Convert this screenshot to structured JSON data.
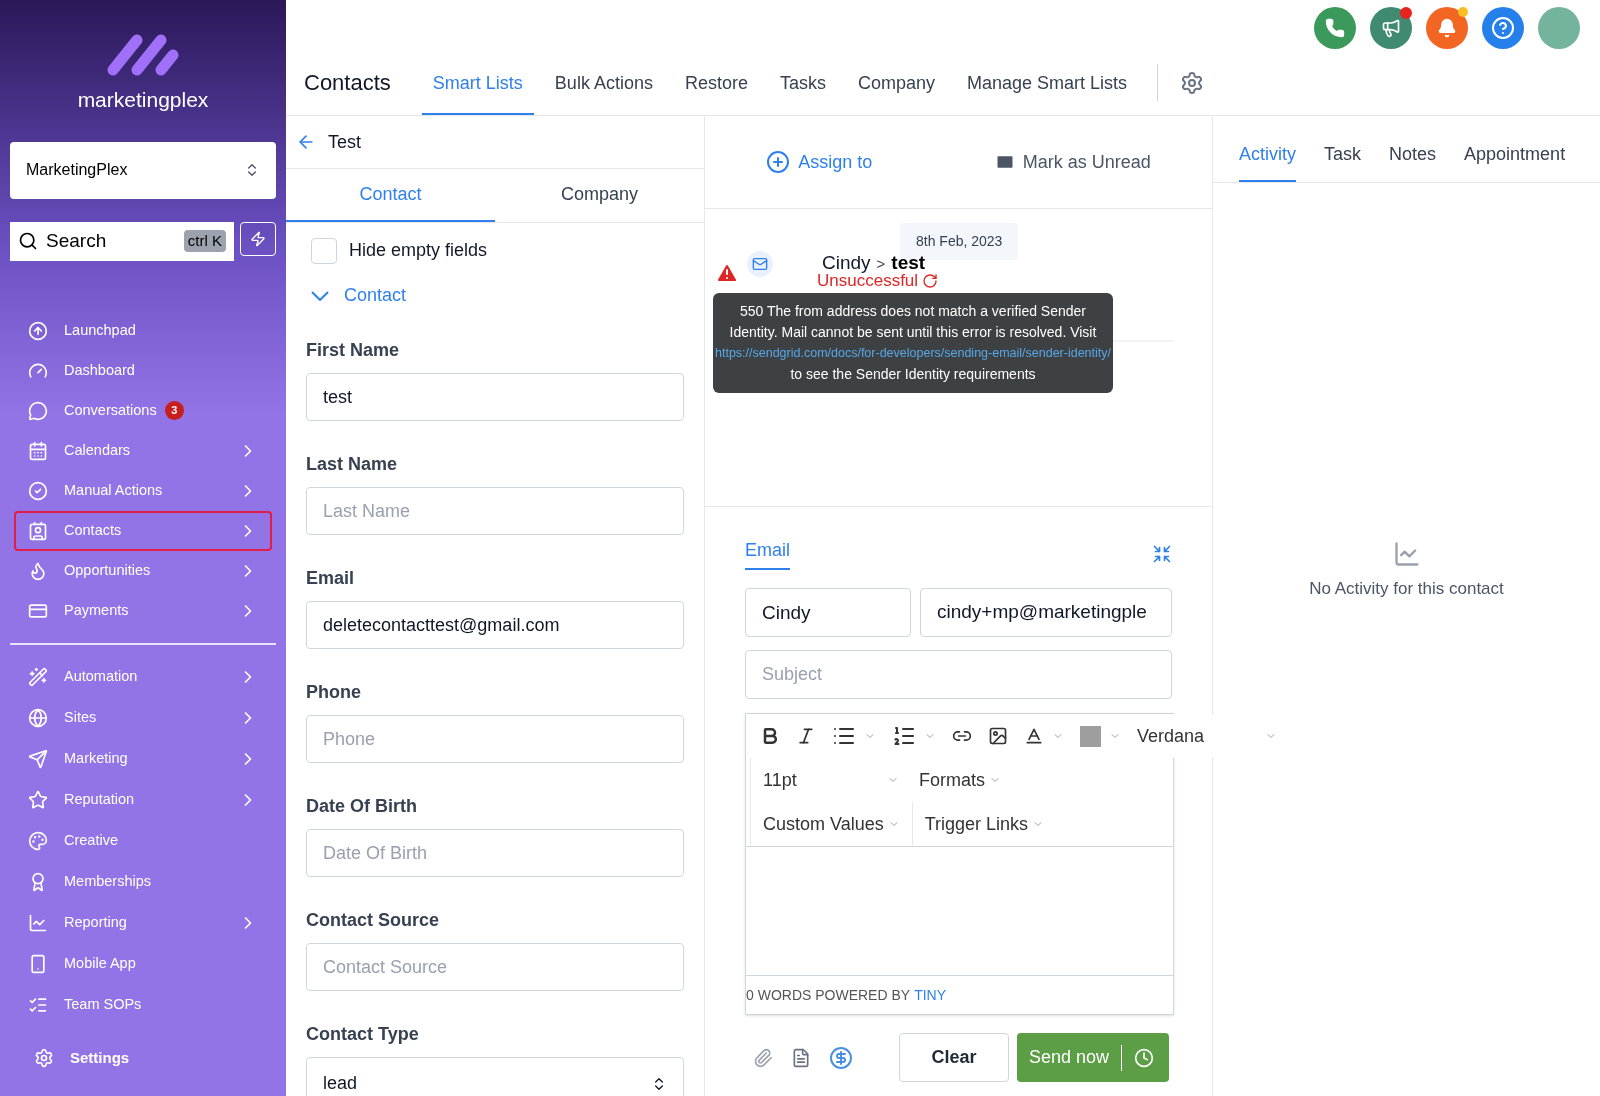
{
  "sidebar": {
    "logo_text": "marketingplex",
    "account": "MarketingPlex",
    "search": {
      "placeholder": "Search",
      "shortcut": "ctrl K"
    },
    "items": [
      {
        "label": "Launchpad",
        "chevron": false,
        "selected": false
      },
      {
        "label": "Dashboard",
        "chevron": false,
        "selected": false
      },
      {
        "label": "Conversations",
        "chevron": false,
        "selected": false,
        "badge": "3"
      },
      {
        "label": "Calendars",
        "chevron": true,
        "selected": false
      },
      {
        "label": "Manual Actions",
        "chevron": true,
        "selected": false
      },
      {
        "label": "Contacts",
        "chevron": true,
        "selected": true
      },
      {
        "label": "Opportunities",
        "chevron": true,
        "selected": false
      },
      {
        "label": "Payments",
        "chevron": true,
        "selected": false
      }
    ],
    "items_2": [
      {
        "label": "Automation",
        "chevron": true
      },
      {
        "label": "Sites",
        "chevron": true
      },
      {
        "label": "Marketing",
        "chevron": true
      },
      {
        "label": "Reputation",
        "chevron": true
      },
      {
        "label": "Creative",
        "chevron": false
      },
      {
        "label": "Memberships",
        "chevron": false
      },
      {
        "label": "Reporting",
        "chevron": true
      },
      {
        "label": "Mobile App",
        "chevron": false
      },
      {
        "label": "Team SOPs",
        "chevron": false
      }
    ],
    "settings": "Settings"
  },
  "header": {
    "title": "Contacts",
    "tabs": [
      {
        "label": "Smart Lists",
        "selected": true
      },
      {
        "label": "Bulk Actions",
        "selected": false
      },
      {
        "label": "Restore",
        "selected": false
      },
      {
        "label": "Tasks",
        "selected": false
      },
      {
        "label": "Company",
        "selected": false
      },
      {
        "label": "Manage Smart Lists",
        "selected": false
      }
    ]
  },
  "contact_panel": {
    "back_label": "Test",
    "tabs": [
      {
        "label": "Contact",
        "selected": true
      },
      {
        "label": "Company",
        "selected": false
      }
    ],
    "hide_empty": {
      "label": "Hide empty fields",
      "checked": false
    },
    "section": {
      "label": "Contact",
      "expanded": true
    },
    "fields": [
      {
        "label": "First Name",
        "value": "test"
      },
      {
        "label": "Last Name",
        "placeholder": "Last Name"
      },
      {
        "label": "Email",
        "value": "deletecontacttest@gmail.com"
      },
      {
        "label": "Phone",
        "placeholder": "Phone"
      },
      {
        "label": "Date Of Birth",
        "placeholder": "Date Of Birth"
      },
      {
        "label": "Contact Source",
        "placeholder": "Contact Source"
      },
      {
        "label": "Contact Type",
        "value": "lead",
        "kind": "select"
      }
    ]
  },
  "conversation": {
    "assign": "Assign to",
    "mark_unread": "Mark as Unread",
    "date": "8th Feb, 2023",
    "message": {
      "from": "Cindy",
      "separator": ">",
      "subject": "test",
      "status": "Unsuccessful"
    },
    "tooltip": {
      "text_before": "550 The from address does not match a verified Sender Identity. Mail cannot be sent until this error is resolved. Visit",
      "link": "https://sendgrid.com/docs/for-developers/sending-email/sender-identity/",
      "text_after": "to see the Sender Identity requirements"
    },
    "composer": {
      "tab": "Email",
      "name": "Cindy",
      "email": "cindy+mp@marketingple",
      "subject_placeholder": "Subject",
      "font": "Verdana",
      "size": "11pt",
      "formats": "Formats",
      "custom_values": "Custom Values",
      "trigger_links": "Trigger Links",
      "footer": "0 WORDS POWERED BY",
      "footer_link": "TINY",
      "clear": "Clear",
      "send": "Send now"
    }
  },
  "activity": {
    "tabs": [
      {
        "label": "Activity",
        "selected": true
      },
      {
        "label": "Task",
        "selected": false
      },
      {
        "label": "Notes",
        "selected": false
      },
      {
        "label": "Appointment",
        "selected": false
      }
    ],
    "empty": "No Activity for this contact"
  }
}
